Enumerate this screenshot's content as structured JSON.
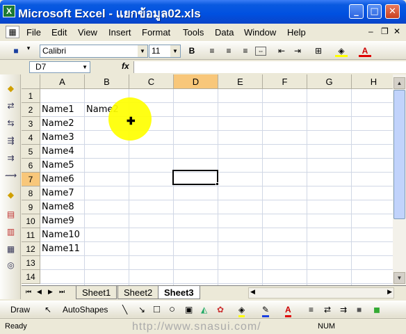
{
  "window": {
    "title": "Microsoft Excel - แยกข้อมูล02.xls",
    "app_icon": "X",
    "buttons": {
      "minimize": "_",
      "maximize": "□",
      "close": "✕"
    }
  },
  "menu": [
    "File",
    "Edit",
    "View",
    "Insert",
    "Format",
    "Tools",
    "Data",
    "Window",
    "Help"
  ],
  "toolbar": {
    "font": "Calibri",
    "size": "11",
    "bold": "B"
  },
  "formula": {
    "name_box": "D7",
    "fx": "fx",
    "value": ""
  },
  "columns": [
    "A",
    "B",
    "C",
    "D",
    "E",
    "F",
    "G",
    "H"
  ],
  "rows": [
    "1",
    "2",
    "3",
    "4",
    "5",
    "6",
    "7",
    "8",
    "9",
    "10",
    "11",
    "12",
    "13",
    "14"
  ],
  "cells": {
    "A2": "Name1",
    "B2": "Name2",
    "A3": "Name2",
    "A4": "Name3",
    "A5": "Name4",
    "A6": "Name5",
    "A7": "Name6",
    "A8": "Name7",
    "A9": "Name8",
    "A10": "Name9",
    "A11": "Name10",
    "A12": "Name11"
  },
  "cell_list": [
    {
      "ref": "A2",
      "text": "Name1"
    },
    {
      "ref": "B2",
      "text": "Name2"
    },
    {
      "ref": "A3",
      "text": "Name2"
    },
    {
      "ref": "A4",
      "text": "Name3"
    },
    {
      "ref": "A5",
      "text": "Name4"
    },
    {
      "ref": "A6",
      "text": "Name5"
    },
    {
      "ref": "A7",
      "text": "Name6"
    },
    {
      "ref": "A8",
      "text": "Name7"
    },
    {
      "ref": "A9",
      "text": "Name8"
    },
    {
      "ref": "A10",
      "text": "Name9"
    },
    {
      "ref": "A11",
      "text": "Name10"
    },
    {
      "ref": "A12",
      "text": "Name11"
    }
  ],
  "sheets": [
    "Sheet1",
    "Sheet2",
    "Sheet3"
  ],
  "active_sheet": "Sheet3",
  "draw_toolbar": {
    "draw": "Draw",
    "autoshapes": "AutoShapes"
  },
  "status": {
    "text": "Ready",
    "num": "NUM",
    "watermark": "http://www.snasui.com/"
  },
  "colors": {
    "title_bar": "#0a5ae0",
    "highlight": "#ffff00",
    "active_col_header": "#f8c77a"
  }
}
